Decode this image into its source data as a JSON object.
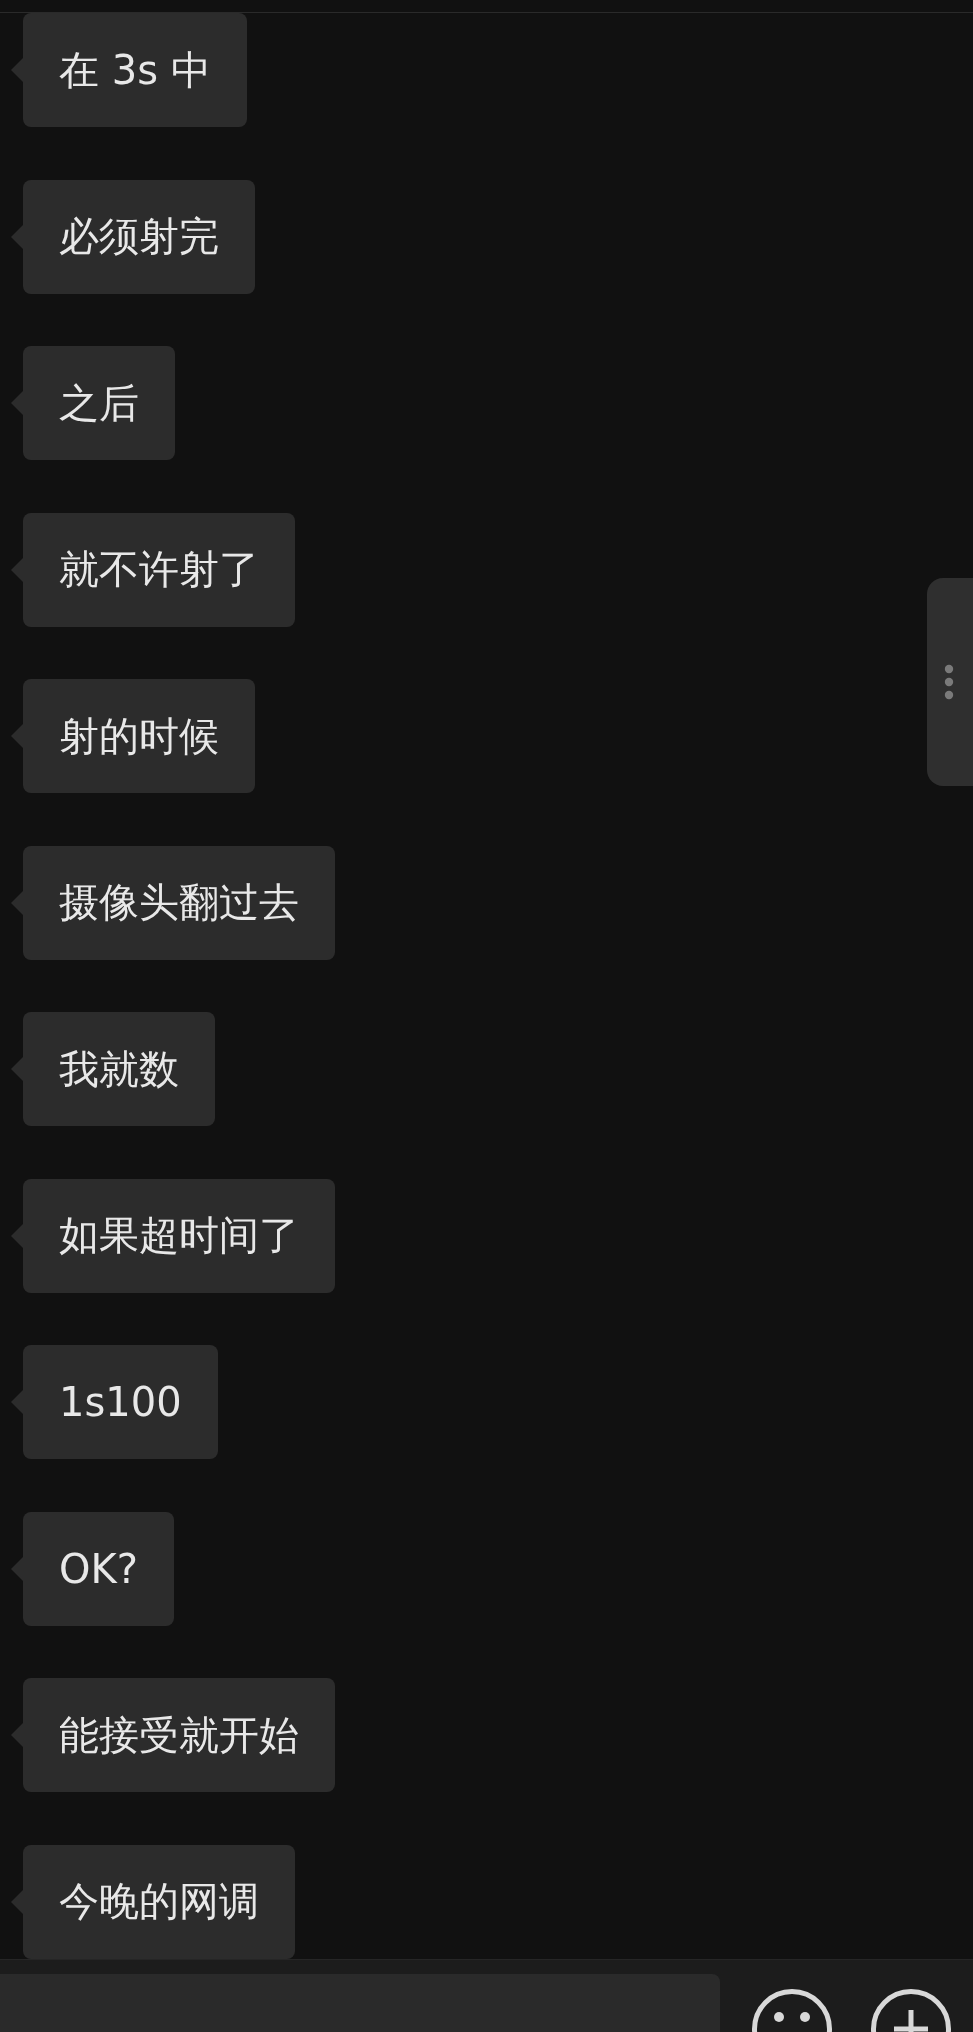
{
  "messages": [
    {
      "text": "在 3s 中"
    },
    {
      "text": "必须射完"
    },
    {
      "text": "之后"
    },
    {
      "text": "就不许射了"
    },
    {
      "text": "射的时候"
    },
    {
      "text": "摄像头翻过去"
    },
    {
      "text": "我就数"
    },
    {
      "text": "如果超时间了"
    },
    {
      "text": "1s100"
    },
    {
      "text": "OK?"
    },
    {
      "text": "能接受就开始"
    },
    {
      "text": "今晚的网调"
    }
  ]
}
